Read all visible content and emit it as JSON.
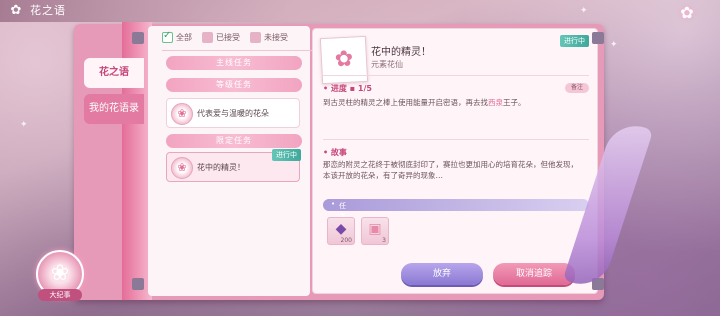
{
  "header": {
    "title": "花之语",
    "flower_icon": "flower-icon"
  },
  "side_tabs": [
    {
      "label": "花之语",
      "active": true
    },
    {
      "label": "我的花语录",
      "active": false
    }
  ],
  "filters": [
    {
      "label": "全部",
      "checked": true
    },
    {
      "label": "已接受",
      "checked": false
    },
    {
      "label": "未接受",
      "checked": false
    }
  ],
  "sections": {
    "main": "主线任务",
    "advanced": "等级任务",
    "limited": "限定任务"
  },
  "tasks": [
    {
      "label": "代表爱与温暖的花朵"
    },
    {
      "label": "花中的精灵！",
      "status": "进行中"
    }
  ],
  "detail": {
    "title": "花中的精灵！",
    "subtitle": "元素花仙",
    "status": "进行中",
    "progress_label": "进度",
    "progress_value": "1/5",
    "remark_button": "备注",
    "progress_text_before": "到古灵柱的精灵之棒上使用能量开启密语，再去找",
    "progress_highlight": "西泉",
    "progress_text_after": "王子。",
    "story_label": "故事",
    "story_text": "那恋的附灵之花终于被彻底封印了，赛拉也更加用心的培育花朵，但他发现，本该开放的花朵，有了奇异的现象…",
    "reward_label": "任务奖励",
    "rewards": [
      {
        "icon": "gem-icon",
        "count": "200"
      },
      {
        "icon": "gift-box-icon",
        "count": "3"
      }
    ],
    "abandon_button": "放弃",
    "cancel_button": "取消追踪"
  },
  "storybook_label": "大纪事"
}
